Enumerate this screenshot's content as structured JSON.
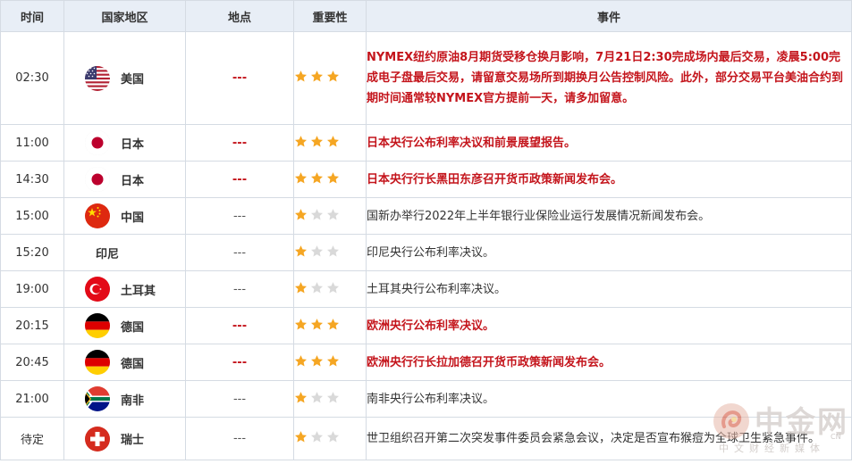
{
  "headers": {
    "time": "时间",
    "country": "国家地区",
    "location": "地点",
    "importance": "重要性",
    "event": "事件"
  },
  "colors": {
    "highlight_red": "#c4151c",
    "star_gold": "#f5a623",
    "star_gray": "#d9d9d9",
    "header_bg": "#e8eef6",
    "border": "#d5dbe3"
  },
  "rows": [
    {
      "time": "02:30",
      "country": "美国",
      "flag": "us-flag-icon",
      "location": "---",
      "stars": 3,
      "highlight": true,
      "event": "NYMEX纽约原油8月期货受移仓换月影响，7月21日2:30完成场内最后交易，凌晨5:00完成电子盘最后交易，请留意交易场所到期换月公告控制风险。此外，部分交易平台美油合约到期时间通常较NYMEX官方提前一天，请多加留意。"
    },
    {
      "time": "11:00",
      "country": "日本",
      "flag": "japan-flag-icon",
      "location": "---",
      "stars": 3,
      "highlight": true,
      "event": "日本央行公布利率决议和前景展望报告。"
    },
    {
      "time": "14:30",
      "country": "日本",
      "flag": "japan-flag-icon",
      "location": "---",
      "stars": 3,
      "highlight": true,
      "event": "日本央行行长黑田东彦召开货币政策新闻发布会。"
    },
    {
      "time": "15:00",
      "country": "中国",
      "flag": "china-flag-icon",
      "location": "---",
      "stars": 1,
      "highlight": false,
      "event": "国新办举行2022年上半年银行业保险业运行发展情况新闻发布会。"
    },
    {
      "time": "15:20",
      "country": "印尼",
      "flag": "",
      "location": "---",
      "stars": 1,
      "highlight": false,
      "event": "印尼央行公布利率决议。"
    },
    {
      "time": "19:00",
      "country": "土耳其",
      "flag": "turkey-flag-icon",
      "location": "---",
      "stars": 1,
      "highlight": false,
      "event": "土耳其央行公布利率决议。"
    },
    {
      "time": "20:15",
      "country": "德国",
      "flag": "germany-flag-icon",
      "location": "---",
      "stars": 3,
      "highlight": true,
      "event": "欧洲央行公布利率决议。"
    },
    {
      "time": "20:45",
      "country": "德国",
      "flag": "germany-flag-icon",
      "location": "---",
      "stars": 3,
      "highlight": true,
      "event": "欧洲央行行长拉加德召开货币政策新闻发布会。"
    },
    {
      "time": "21:00",
      "country": "南非",
      "flag": "south-africa-flag-icon",
      "location": "---",
      "stars": 1,
      "highlight": false,
      "event": "南非央行公布利率决议。"
    },
    {
      "time": "待定",
      "country": "瑞士",
      "flag": "switzerland-flag-icon",
      "location": "---",
      "stars": 1,
      "highlight": false,
      "event": "世卫组织召开第二次突发事件委员会紧急会议，决定是否宣布猴痘为全球卫生紧急事件。"
    }
  ],
  "watermark": {
    "name": "中金网",
    "cn": "CN",
    "sub": "中文财经新媒体"
  }
}
